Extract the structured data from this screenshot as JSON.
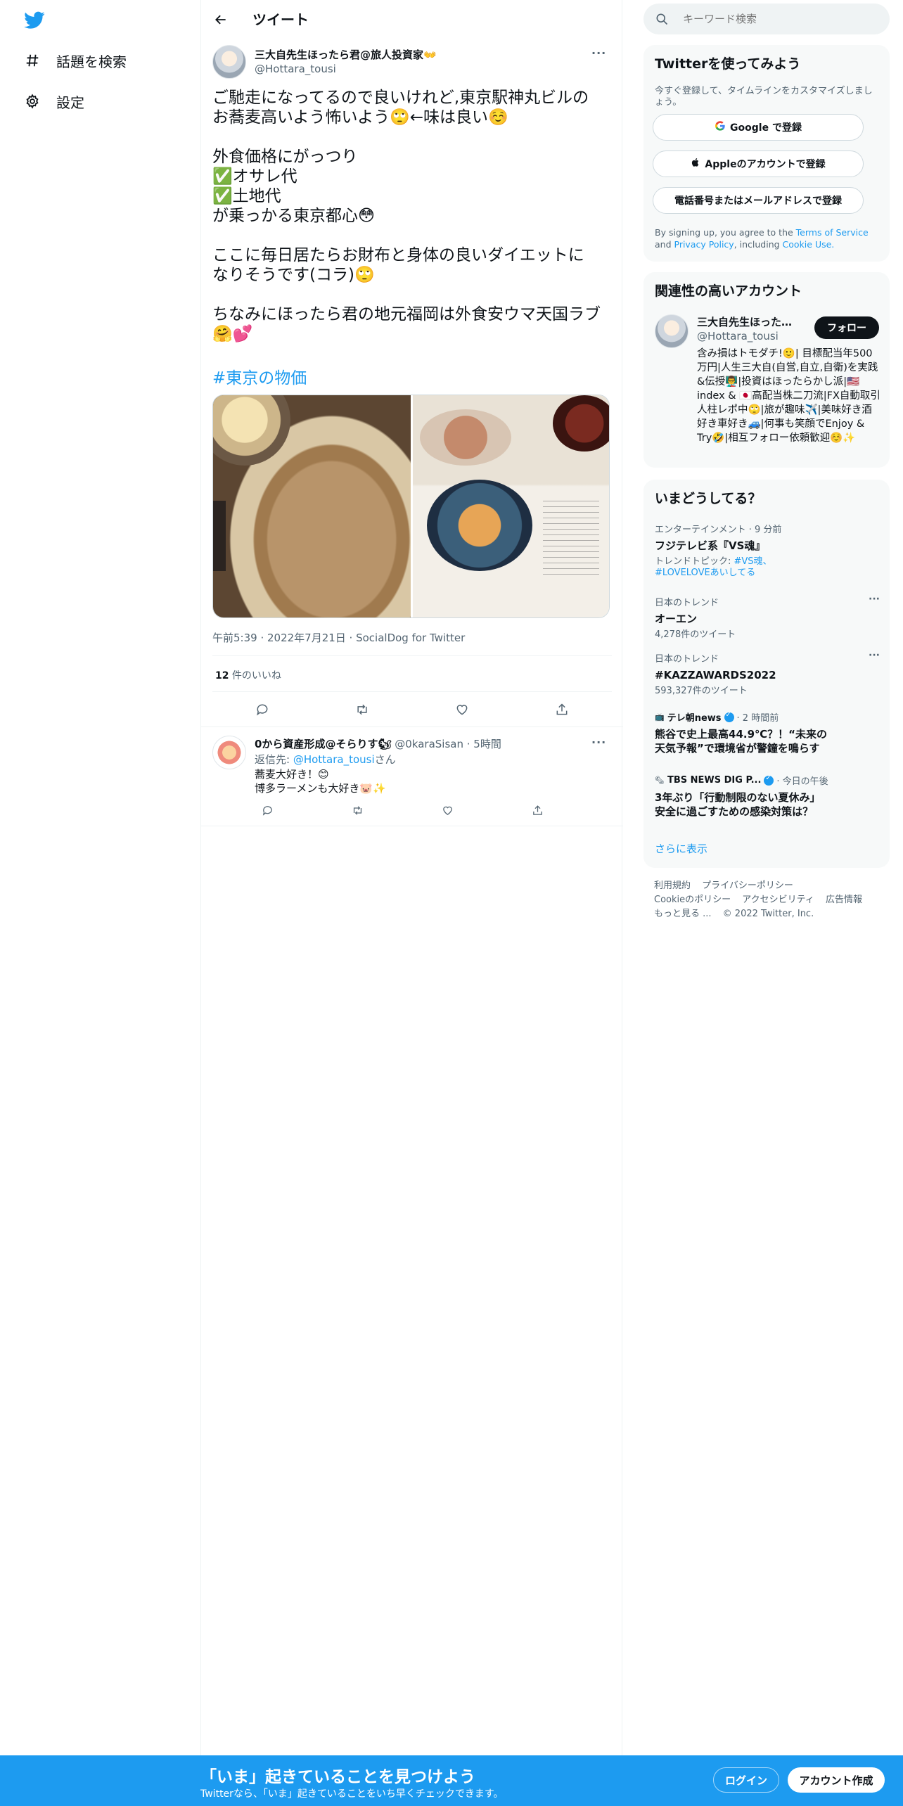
{
  "nav": {
    "logo_icon": "twitter-bird-icon",
    "brand_color": "#1d9bf0",
    "items": [
      {
        "label": "話題を検索",
        "icon": "hashtag-icon"
      },
      {
        "label": "設定",
        "icon": "gear-icon"
      }
    ]
  },
  "header": {
    "title": "ツイート",
    "back_icon": "back-arrow-icon"
  },
  "tweet": {
    "author_name": "三大自先生ほったら君@旅人投資家👐",
    "author_handle": "@Hottara_tousi",
    "text": "ご馳走になってるので良いけれど,東京駅神丸ビルの\nお蕎麦高いよう怖いよう🙄←味は良い☺️\n\n外食価格にがっつり\n✅オサレ代\n✅土地代\nが乗っかる東京都心😳\n\nここに毎日居たらお財布と身体の良いダイエットに\nなりそうです(コラ)🙄\n\nちなみにほったら君の地元福岡は外食安ウマ天国ラブ\n🤗💕",
    "hashtag": "#東京の物価",
    "meta": "午前5:39 · 2022年7月21日 · SocialDog for Twitter",
    "likes_count": "12",
    "likes_label": " 件のいいね"
  },
  "reply": {
    "name": "0から資産形成@そらりす🐿",
    "handle_time": " @0karaSisan · 5時間",
    "reply_prefix": "返信先: ",
    "reply_to": "@Hottara_tousi",
    "reply_suffix": "さん",
    "text": "蕎麦大好き！😊\n博多ラーメンも大好き🐷✨"
  },
  "search": {
    "placeholder": "キーワード検索"
  },
  "signup_card": {
    "title": "Twitterを使ってみよう",
    "subtitle": "今すぐ登録して、タイムラインをカスタマイズしましょう。",
    "google_button": "Google で登録",
    "apple_button": "Appleのアカウントで登録",
    "phone_button": "電話番号またはメールアドレスで登録",
    "legal_prefix": "By signing up, you agree to the ",
    "terms": "Terms of Service",
    "and": " and ",
    "privacy": "Privacy Policy",
    "including": ", including ",
    "cookie": "Cookie Use."
  },
  "relevant": {
    "title": "関連性の高いアカウント",
    "name": "三大自先生ほったら君@旅人投資家👐",
    "handle": "@Hottara_tousi",
    "follow_button": "フォロー",
    "bio": "含み損はトモダチ!🙂| 目標配当年500万円|人生三大自(自営,自立,自衛)を実践&伝授👨‍🏫|投資はほったらかし派|🇺🇸index & 🇯🇵高配当株二刀流|FX自動取引人柱レポ中🙄|旅が趣味✈️|美味好き酒好き車好き🚙|何事も笑顔でEnjoy & Try🤣|相互フォロー依頼歓迎☺️✨"
  },
  "trends": {
    "title": "いまどうしてる？",
    "items": [
      {
        "category": "エンターテインメント · 9 分前",
        "name": "フジテレビ系『VS魂』",
        "sub_prefix": "トレンドトピック: ",
        "sub_link": "#VS魂、#LOVELOVEあいしてる"
      },
      {
        "category": "日本のトレンド",
        "name": "オーエン",
        "sub": "4,278件のツイート"
      },
      {
        "category": "日本のトレンド",
        "name": "#KAZZAWARDS2022",
        "sub": "593,327件のツイート"
      },
      {
        "source": "テレ朝news",
        "time": " · 2 時間前",
        "name": "熊谷で史上最高44.9℃？！“未来の天気予報”で環境省が警鐘を鳴らす"
      },
      {
        "source": "TBS NEWS DIG P...",
        "time": " · 今日の午後",
        "name": "3年ぶり「行動制限のない夏休み」安全に過ごすための感染対策は？"
      }
    ],
    "show_more": "さらに表示"
  },
  "footer": {
    "links": [
      "利用規約",
      "プライバシーポリシー",
      "Cookieのポリシー",
      "アクセシビリティ",
      "広告情報",
      "もっと見る ...",
      "© 2022 Twitter, Inc."
    ]
  },
  "banner": {
    "headline": "「いま」起きていることを見つけよう",
    "subline": "Twitterなら、「いま」起きていることをいち早くチェックできます。",
    "login": "ログイン",
    "signup": "アカウント作成"
  }
}
